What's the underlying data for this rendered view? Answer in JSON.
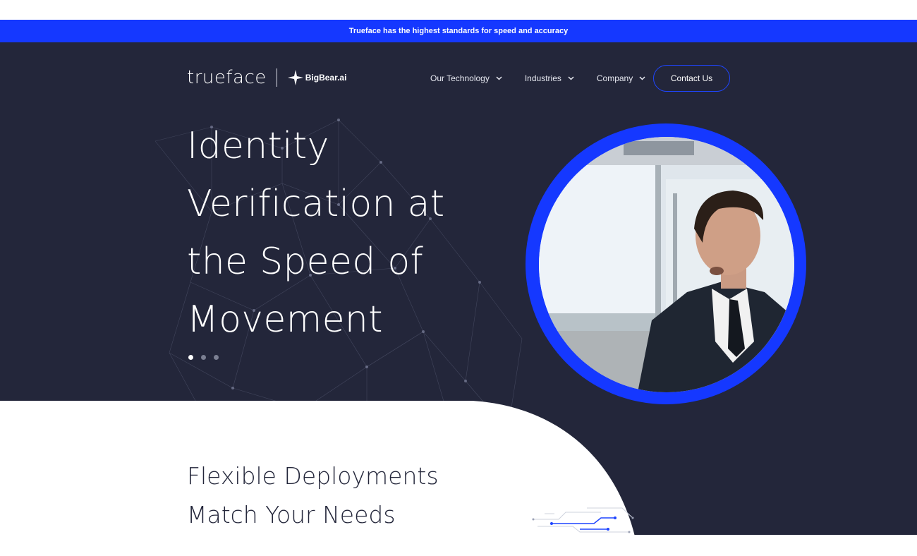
{
  "announcement": {
    "text": "Trueface has the highest standards for speed and accuracy"
  },
  "header": {
    "logo_text": "trueface",
    "partner_logo_text": "BigBear.ai",
    "nav": [
      {
        "label": "Our Technology",
        "icon": "chevron-down-icon"
      },
      {
        "label": "Industries",
        "icon": "chevron-down-icon"
      },
      {
        "label": "Company",
        "icon": "chevron-down-icon"
      }
    ],
    "cta_label": "Contact Us"
  },
  "hero": {
    "headline_lines": [
      "Identity",
      "Verification at",
      "the Speed of",
      "Movement"
    ],
    "slides": {
      "count": 3,
      "active": 1
    }
  },
  "section": {
    "title_lines": [
      "Flexible Deployments",
      "Match Your Needs"
    ]
  },
  "colors": {
    "accent_blue": "#1538ff",
    "hero_background": "#23263a",
    "page_background": "#ffffff"
  }
}
